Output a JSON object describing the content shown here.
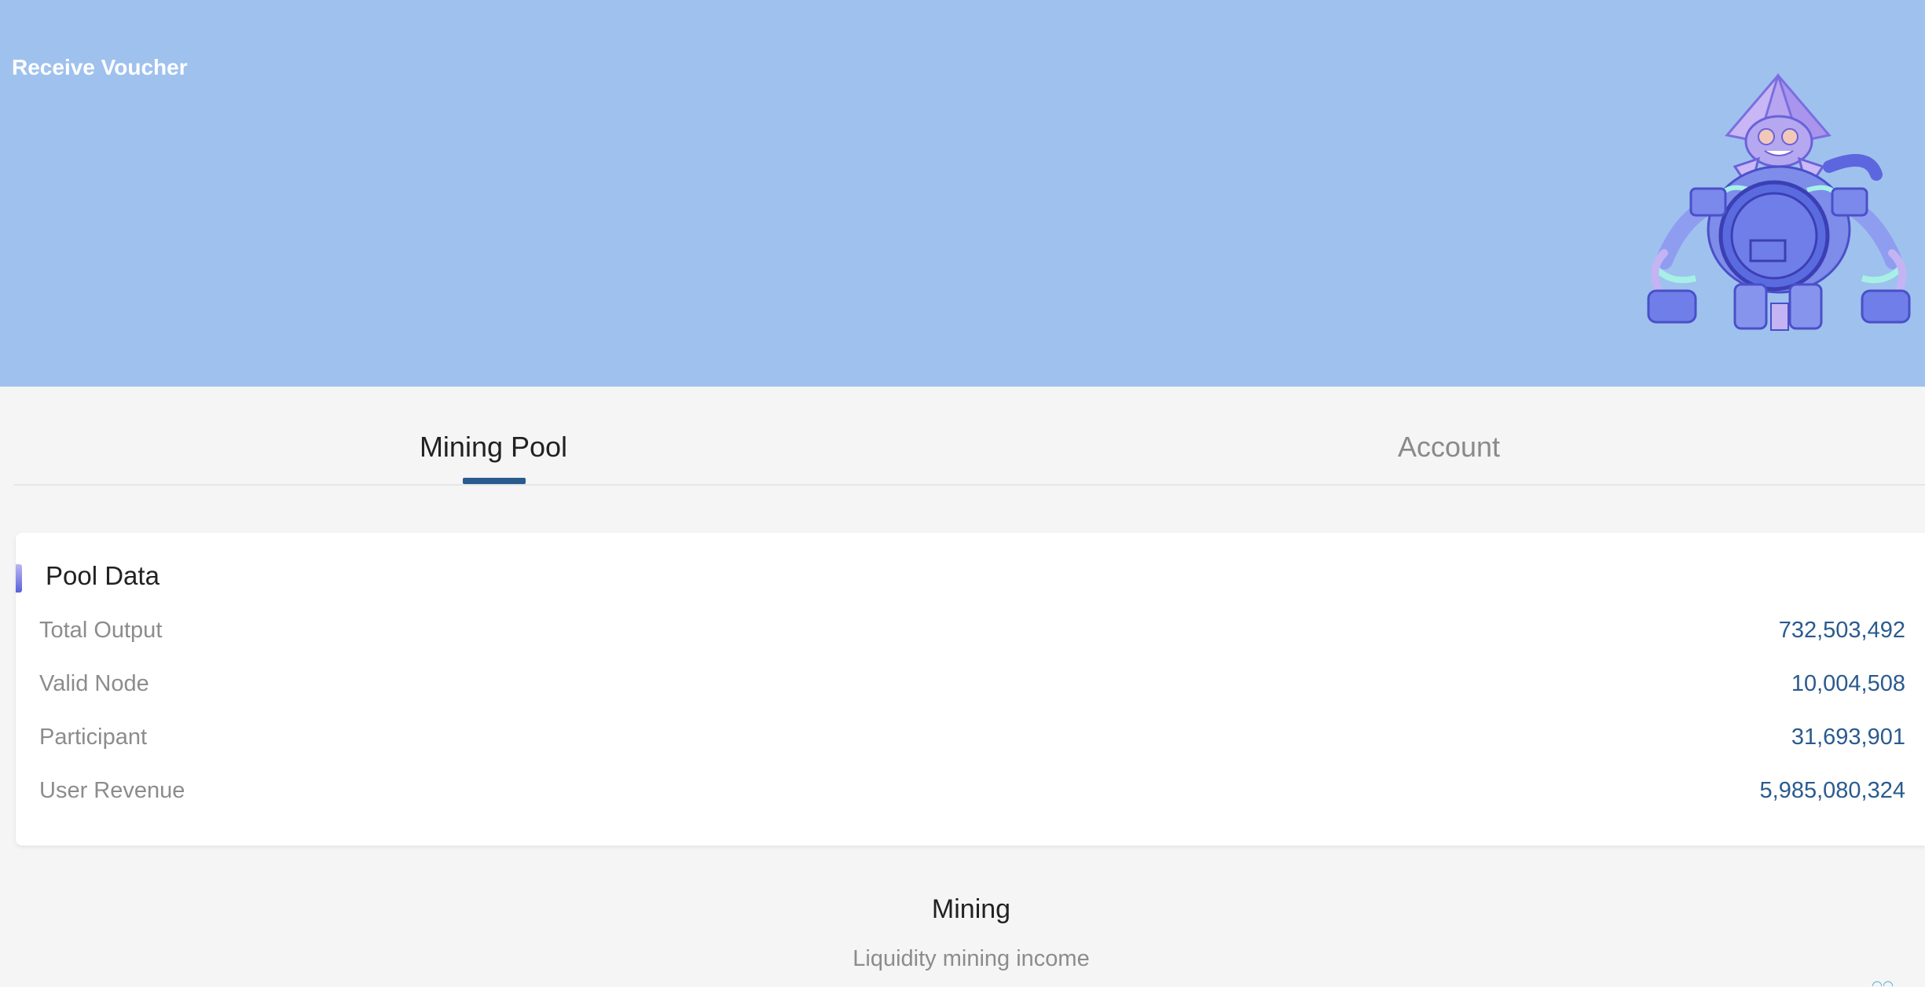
{
  "header": {
    "voucher_label": "Receive Voucher",
    "background_color": "#9fc1ee",
    "mascot": "robot-mascot-illustration"
  },
  "tabs": [
    {
      "label": "Mining Pool",
      "active": true
    },
    {
      "label": "Account",
      "active": false
    }
  ],
  "pool": {
    "title": "Pool Data",
    "rows": [
      {
        "label": "Total Output",
        "value": "732,503,492"
      },
      {
        "label": "Valid Node",
        "value": "10,004,508"
      },
      {
        "label": "Participant",
        "value": "31,693,901"
      },
      {
        "label": "User Revenue",
        "value": "5,985,080,324"
      }
    ]
  },
  "mining": {
    "title": "Mining",
    "subtitle": "Liquidity mining income"
  },
  "colors": {
    "accent": "#2a5b8e",
    "muted_text": "#8c8c8c",
    "page_background": "#f5f5f5"
  }
}
